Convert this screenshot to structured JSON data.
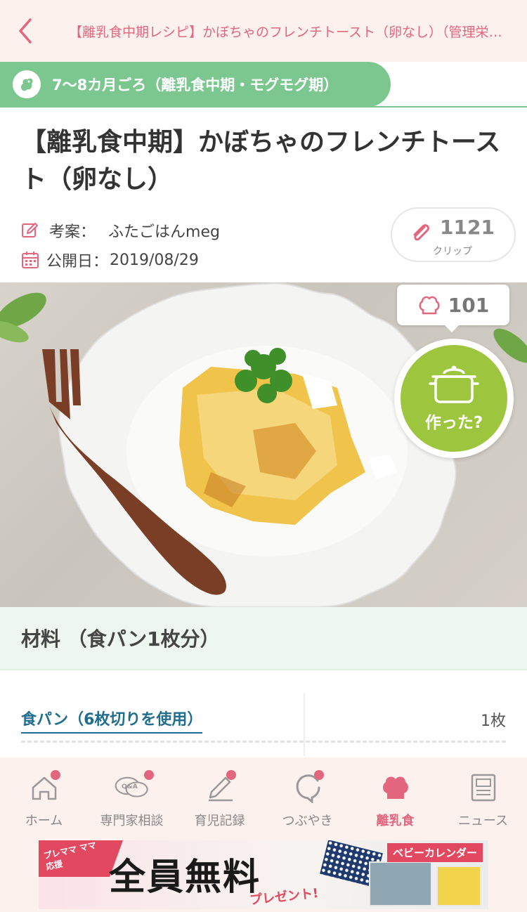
{
  "header": {
    "title": "【離乳食中期レシピ】かぼちゃのフレンチトースト（卵なし）（管理栄養士監修）"
  },
  "age_banner": {
    "text": "7〜8カ月ごろ（離乳食中期・モグモグ期）"
  },
  "recipe": {
    "title": "【離乳食中期】かぼちゃのフレンチトースト（卵なし）",
    "author_label": "考案：",
    "author_name": "ふたごはんmeg",
    "date_label": "公開日：",
    "date_value": "2019/08/29"
  },
  "clip": {
    "count": "1121",
    "label": "クリップ"
  },
  "made": {
    "count": "101",
    "button_label": "作った?"
  },
  "ingredients": {
    "title": "材料 （食パン1枚分）",
    "items": [
      {
        "name": "食パン（6枚切りを使用）",
        "qty": "1枚"
      }
    ]
  },
  "nav": {
    "items": [
      {
        "label": "ホーム",
        "icon": "home-icon"
      },
      {
        "label": "専門家相談",
        "icon": "qa-icon"
      },
      {
        "label": "育児記録",
        "icon": "pencil-icon"
      },
      {
        "label": "つぶやき",
        "icon": "chat-icon"
      },
      {
        "label": "離乳食",
        "icon": "chef-hat-icon"
      },
      {
        "label": "ニュース",
        "icon": "news-icon"
      }
    ]
  },
  "ad": {
    "small_text": "プレママ ママ応援",
    "main_text": "全員無料",
    "sub_text": "プレゼント!",
    "brand": "ベビーカレンダー"
  },
  "colors": {
    "accent_pink": "#e2667d",
    "banner_green": "#7cc790",
    "button_green": "#9dc63e",
    "link_blue": "#1f6d8f"
  }
}
